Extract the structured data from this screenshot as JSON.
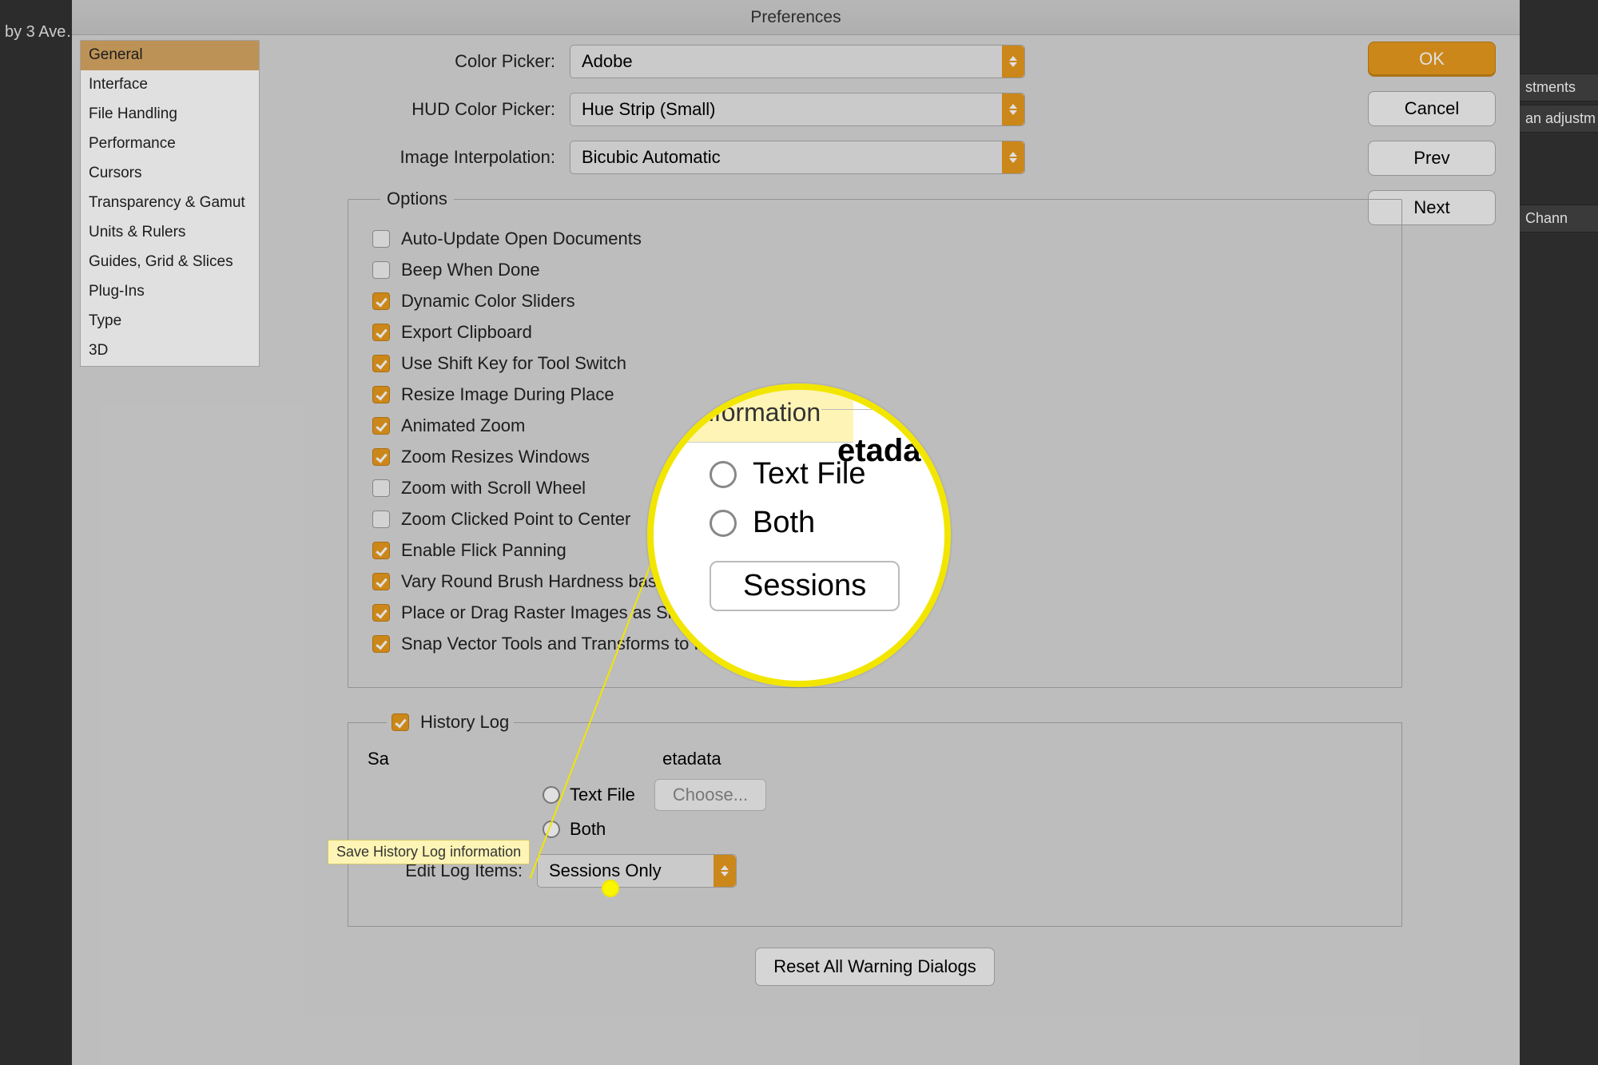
{
  "background": {
    "tab": "by 3 Ave…",
    "panels": [
      "stments",
      "an adjustm",
      "Chann"
    ]
  },
  "dialog": {
    "title": "Preferences"
  },
  "sidebar": [
    "General",
    "Interface",
    "File Handling",
    "Performance",
    "Cursors",
    "Transparency & Gamut",
    "Units & Rulers",
    "Guides, Grid & Slices",
    "Plug-Ins",
    "Type",
    "3D"
  ],
  "buttons": {
    "ok": "OK",
    "cancel": "Cancel",
    "prev": "Prev",
    "next": "Next"
  },
  "form": {
    "colorPicker": {
      "label": "Color Picker:",
      "value": "Adobe"
    },
    "hudPicker": {
      "label": "HUD Color Picker:",
      "value": "Hue Strip (Small)"
    },
    "interp": {
      "label": "Image Interpolation:",
      "value": "Bicubic Automatic"
    }
  },
  "options": {
    "legend": "Options",
    "items": [
      "Auto-Update Open Documents",
      "Beep When Done",
      "Dynamic Color Sliders",
      "Export Clipboard",
      "Use Shift Key for Tool Switch",
      "Resize Image During Place",
      "Animated Zoom",
      "Zoom Resizes Windows",
      "Zoom with Scroll Wheel",
      "Zoom Clicked Point to Center",
      "Enable Flick Panning",
      "Vary Round Brush Hardness based on HUD vertical movement",
      "Place or Drag Raster Images as Smart Objects",
      "Snap Vector Tools and Transforms to Pixel Grid"
    ]
  },
  "history": {
    "legend": "History Log",
    "saveLabelPrefix": "Sa",
    "metadata": "etadata",
    "textfile": "Text File",
    "choose": "Choose...",
    "both": "Both",
    "editLabel": "Edit Log Items:",
    "editValue": "Sessions Only"
  },
  "resetBtn": "Reset All Warning Dialogs",
  "tooltip": "Save History Log information",
  "mag": {
    "tip": "nformation",
    "meta": "etadata",
    "text": "Text File",
    "both": "Both",
    "sessions": "Sessions"
  }
}
